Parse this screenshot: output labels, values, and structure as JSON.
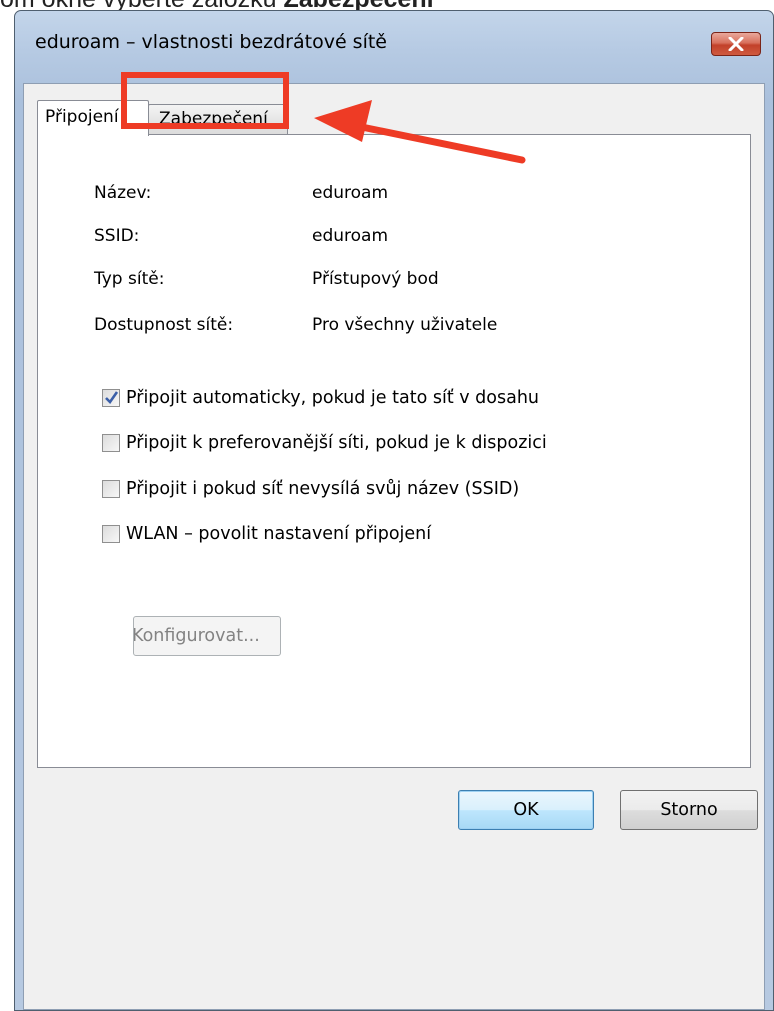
{
  "instruction": {
    "prefix": "om okně vyberte záložku ",
    "bold": "Zabezpečení"
  },
  "window": {
    "title": "eduroam – vlastnosti bezdrátové sítě",
    "close_label": "×"
  },
  "tabs": [
    {
      "label": "Připojení",
      "active": true
    },
    {
      "label": "Zabezpečení",
      "active": false
    }
  ],
  "info": [
    {
      "label": "Název:",
      "value": "eduroam"
    },
    {
      "label": "SSID:",
      "value": "eduroam"
    },
    {
      "label": "Typ sítě:",
      "value": "Přístupový bod"
    },
    {
      "label": "Dostupnost sítě:",
      "value": "Pro všechny uživatele"
    }
  ],
  "options": [
    {
      "label": "Připojit automaticky, pokud je tato síť v dosahu",
      "checked": true
    },
    {
      "label": "Připojit k preferovanější síti, pokud je k dispozici",
      "checked": false
    },
    {
      "label": "Připojit i pokud síť nevysílá svůj název (SSID)",
      "checked": false
    },
    {
      "label": "WLAN – povolit nastavení připojení",
      "checked": false
    }
  ],
  "configure_button": "Konfigurovat...",
  "buttons": {
    "ok": "OK",
    "cancel": "Storno"
  },
  "colors": {
    "highlight": "#ee3b25",
    "title_bar": "#b6cae3",
    "panel": "#ffffff"
  }
}
